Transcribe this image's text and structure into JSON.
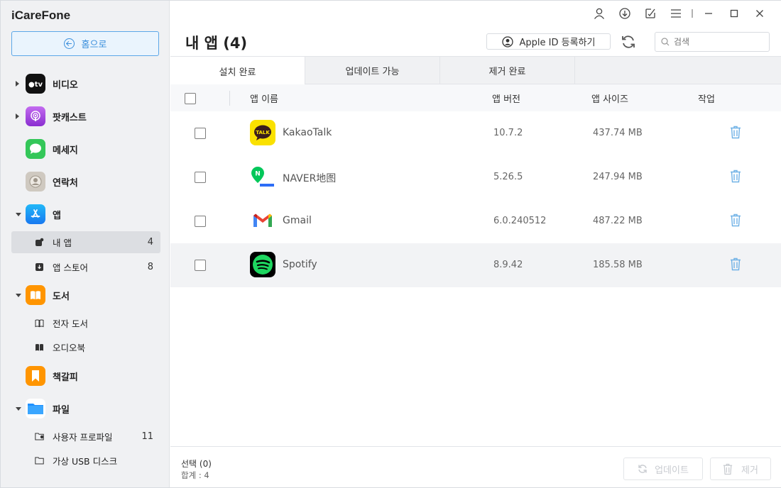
{
  "app": {
    "brand": "iCareFone"
  },
  "sidebar": {
    "home_label": "홈으로",
    "items": [
      {
        "label": "비디오",
        "icon": "apple-tv-icon"
      },
      {
        "label": "팟캐스트",
        "icon": "podcast-icon"
      },
      {
        "label": "메세지",
        "icon": "messages-icon"
      },
      {
        "label": "연락처",
        "icon": "contacts-icon"
      },
      {
        "label": "앱",
        "icon": "app-store-icon"
      },
      {
        "label": "도서",
        "icon": "books-icon"
      },
      {
        "label": "책갈피",
        "icon": "bookmark-icon"
      },
      {
        "label": "파일",
        "icon": "files-icon"
      }
    ],
    "app_sub": [
      {
        "label": "내 앱",
        "count": "4"
      },
      {
        "label": "앱 스토어",
        "count": "8"
      }
    ],
    "book_sub": [
      {
        "label": "전자 도서"
      },
      {
        "label": "오디오북"
      }
    ],
    "file_sub": [
      {
        "label": "사용자 프로파일",
        "count": "11"
      },
      {
        "label": "가상 USB 디스크"
      }
    ]
  },
  "main": {
    "title": "내 앱 (4)",
    "apple_id_label": "Apple ID 등록하기",
    "search_placeholder": "검색",
    "tabs": [
      {
        "label": "설치 완료"
      },
      {
        "label": "업데이트 가능"
      },
      {
        "label": "제거 완료"
      }
    ],
    "columns": {
      "name": "앱 이름",
      "version": "앱 버전",
      "size": "앱 사이즈",
      "action": "작업"
    },
    "rows": [
      {
        "name": "KakaoTalk",
        "version": "10.7.2",
        "size": "437.74 MB"
      },
      {
        "name": "NAVER地图",
        "version": "5.26.5",
        "size": "247.94 MB"
      },
      {
        "name": "Gmail",
        "version": "6.0.240512",
        "size": "487.22 MB"
      },
      {
        "name": "Spotify",
        "version": "8.9.42",
        "size": "185.58 MB"
      }
    ],
    "footer": {
      "selected": "선택 (0)",
      "total": "합계 : 4",
      "update_label": "업데이트",
      "remove_label": "제거"
    }
  },
  "colors": {
    "accent": "#3b8fdc",
    "trash": "#6fb1e6",
    "kakao": "#fae100",
    "naver": "#03c75a",
    "spotify": "#1ed760"
  }
}
